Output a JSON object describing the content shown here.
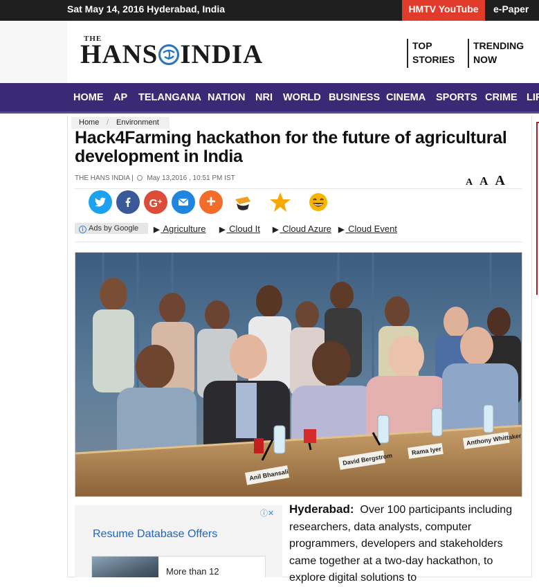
{
  "topbar": {
    "date_location": "Sat May 14, 2016 Hyderabad, India",
    "hmtv_link": "HMTV YouTube",
    "epaper_link": "e-Paper"
  },
  "header": {
    "logo_small": "THE",
    "logo_left": "HANS",
    "logo_right": "INDIA",
    "top_stories_line1": "TOP",
    "top_stories_line2": "STORIES",
    "trending_line1": "TRENDING",
    "trending_line2": "NOW"
  },
  "nav": {
    "items": [
      "HOME",
      "AP",
      "TELANGANA",
      "NATION",
      "NRI",
      "WORLD",
      "BUSINESS",
      "CINEMA",
      "SPORTS",
      "CRIME",
      "LIF"
    ]
  },
  "breadcrumb": {
    "home": "Home",
    "separator": "/",
    "section": "Environment"
  },
  "article": {
    "headline": "Hack4Farming hackathon for the future of agricultural development in India",
    "source": "THE HANS INDIA |",
    "date": "May 13,2016 , 10:51 PM IST",
    "font_sizes": [
      "A",
      "A",
      "A"
    ],
    "lead_label": "Hyderabad:",
    "lead_text": "Over 100 participants including researchers, data analysts, computer programmers, developers and stakeholders came together at a two-day hackathon, to explore digital solutions to"
  },
  "share": {
    "icons": [
      "twitter-icon",
      "facebook-icon",
      "google-plus-icon",
      "email-icon",
      "more-share-icon",
      "hat-reaction-icon",
      "star-reaction-icon",
      "smile-reaction-icon"
    ],
    "colors": {
      "twitter": "#1da1f2",
      "facebook": "#3b5998",
      "google": "#dd4b39",
      "email": "#1f86e0",
      "more": "#f26c2a"
    }
  },
  "ads_row": {
    "label": "Ads by Google",
    "links": [
      "Agriculture",
      "Cloud It",
      "Cloud Azure",
      "Cloud Event"
    ]
  },
  "photo": {
    "nameplates": [
      "Anil Bhansali",
      "David Bergstrom",
      "Rama Iyer",
      "Anthony Whittaker"
    ]
  },
  "ad_box": {
    "close": "ⓘ✕",
    "title": "Resume Database Offers",
    "card_text": "More than 12"
  },
  "colors": {
    "nav_bg": "#3a2a75",
    "hmtv_bg": "#e13b2b",
    "topbar_bg": "#1f1f1f",
    "ad_link": "#1a66c9"
  }
}
